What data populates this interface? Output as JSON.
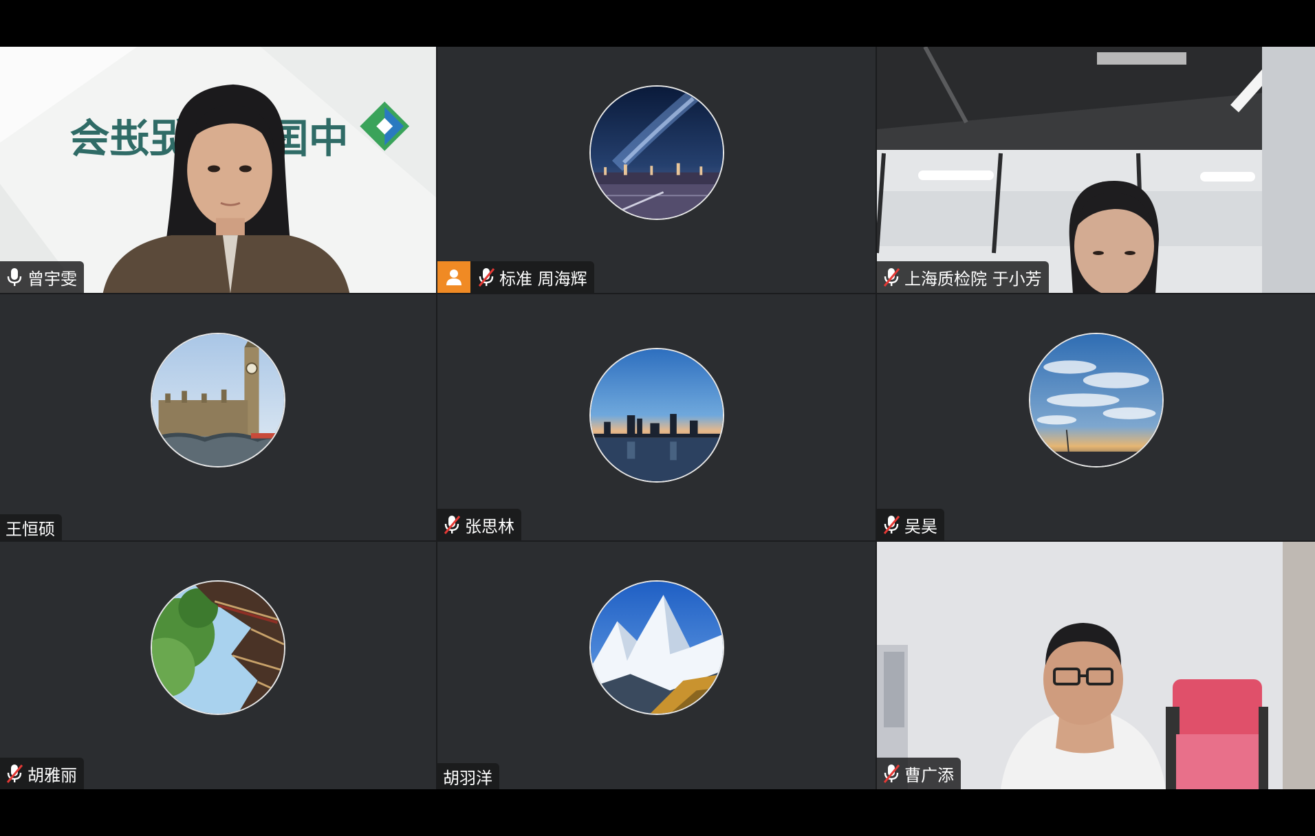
{
  "meeting": {
    "participants": [
      {
        "name": "曾宇雯",
        "mic": "on",
        "tile": "video-banner",
        "banner_text": "中国环保促进会"
      },
      {
        "name": "标准  周海辉",
        "mic": "muted",
        "tile": "avatar",
        "avatar": "milky-way-night-sky",
        "host_badge": true
      },
      {
        "name": "上海质检院 于小芳",
        "mic": "muted",
        "tile": "video-office"
      },
      {
        "name": "王恒硕",
        "mic": "none",
        "tile": "avatar",
        "avatar": "big-ben-london"
      },
      {
        "name": "张思林",
        "mic": "muted",
        "tile": "avatar",
        "avatar": "city-skyline-dusk"
      },
      {
        "name": "吴昊",
        "mic": "muted",
        "tile": "avatar",
        "avatar": "cloudy-sky-sunset"
      },
      {
        "name": "胡雅丽",
        "mic": "muted",
        "tile": "avatar",
        "avatar": "temple-roof-tree"
      },
      {
        "name": "胡羽洋",
        "mic": "none",
        "tile": "avatar",
        "avatar": "snow-mountain"
      },
      {
        "name": "曹广添",
        "mic": "muted",
        "tile": "video-man"
      }
    ]
  },
  "colors": {
    "tile_bg": "#2b2d30",
    "host_badge": "#f08a24",
    "muted_slash": "#e53935"
  }
}
